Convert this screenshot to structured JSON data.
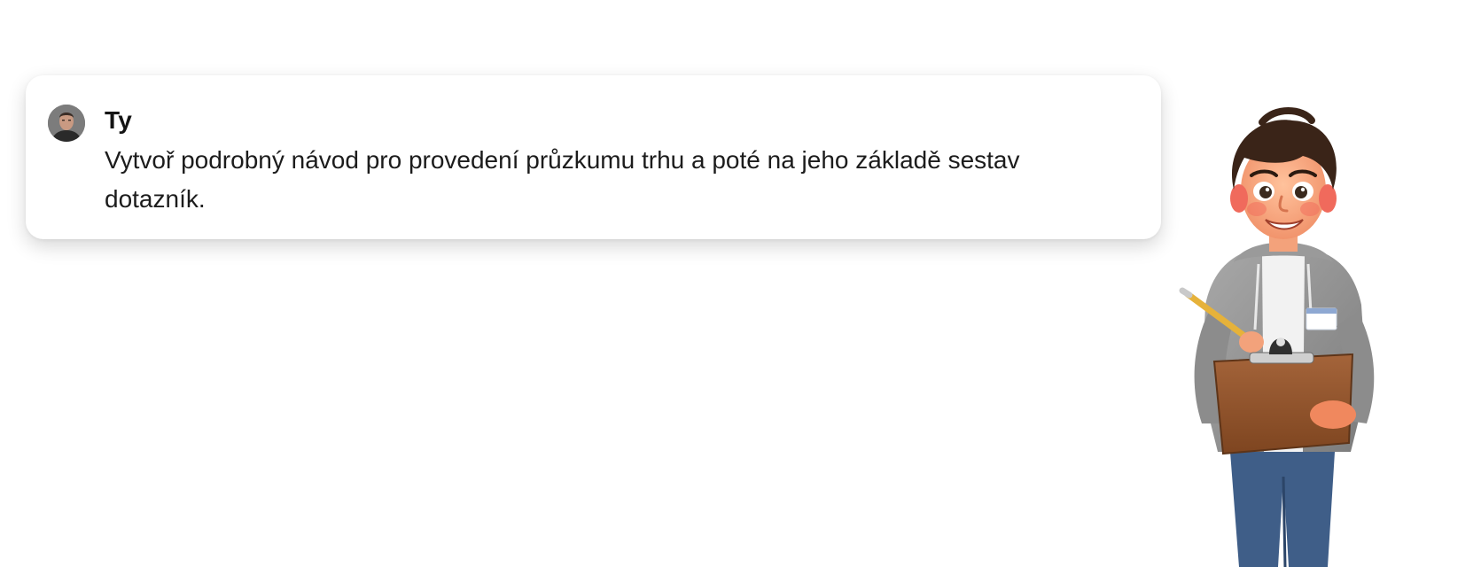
{
  "message": {
    "author": "Ty",
    "text": "Vytvoř podrobný návod pro provedení průzkumu trhu a poté na jeho základě sestav dotazník."
  },
  "avatar": {
    "icon": "user-avatar-photo"
  },
  "illustration": {
    "icon": "researcher-with-clipboard"
  }
}
